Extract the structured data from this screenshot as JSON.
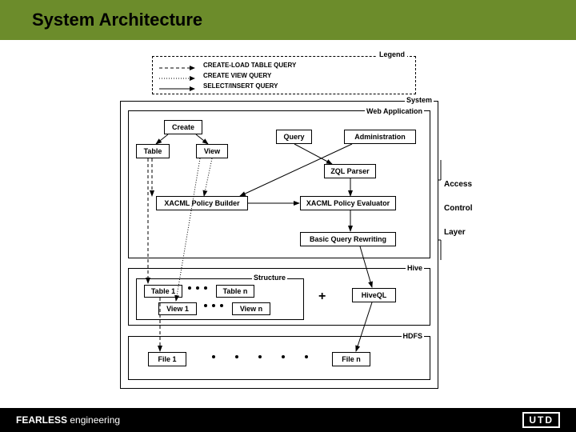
{
  "header": {
    "title": "System Architecture"
  },
  "legend": {
    "label": "Legend",
    "items": [
      {
        "text": "CREATE-LOAD TABLE QUERY"
      },
      {
        "text": "CREATE VIEW QUERY"
      },
      {
        "text": "SELECT/INSERT QUERY"
      }
    ]
  },
  "system": {
    "label": "System",
    "webapp": {
      "label": "Web Application",
      "create": "Create",
      "table": "Table",
      "view": "View",
      "query": "Query",
      "admin": "Administration",
      "zql": "ZQL Parser",
      "builder": "XACML Policy Builder",
      "evaluator": "XACML Policy Evaluator",
      "rewriting": "Basic Query Rewriting"
    },
    "side_labels": {
      "access": "Access",
      "control": "Control",
      "layer": "Layer"
    },
    "hive": {
      "label": "Hive",
      "structure_label": "Structure",
      "table1": "Table 1",
      "tablen": "Table n",
      "view1": "View 1",
      "viewn": "View n",
      "plus": "+",
      "hiveql": "HiveQL"
    },
    "hdfs": {
      "label": "HDFS",
      "file1": "File 1",
      "filen": "File n"
    }
  },
  "footer": {
    "bold": "FEARLESS",
    "rest": " engineering",
    "logo": "UTD"
  }
}
